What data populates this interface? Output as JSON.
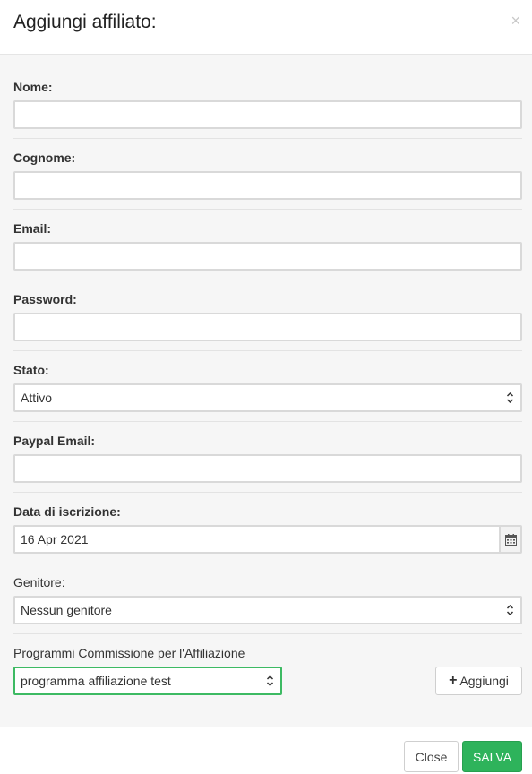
{
  "modal": {
    "title": "Aggiungi affiliato:",
    "close_glyph": "×"
  },
  "form": {
    "nome": {
      "label": "Nome:",
      "value": ""
    },
    "cognome": {
      "label": "Cognome:",
      "value": ""
    },
    "email": {
      "label": "Email:",
      "value": ""
    },
    "password": {
      "label": "Password:",
      "value": ""
    },
    "stato": {
      "label": "Stato:",
      "selected": "Attivo"
    },
    "paypal_email": {
      "label": "Paypal Email:",
      "value": ""
    },
    "data_iscrizione": {
      "label": "Data di iscrizione:",
      "value": "16 Apr 2021"
    },
    "genitore": {
      "label": "Genitore:",
      "selected": "Nessun genitore"
    },
    "programmi": {
      "label": "Programmi Commissione per l'Affiliazione",
      "selected": "programma affiliazione test",
      "add_label": "Aggiungi"
    }
  },
  "footer": {
    "close_label": "Close",
    "save_label": "SALVA"
  },
  "colors": {
    "save_button": "#2eb35b",
    "focus_border": "#3dba63"
  },
  "icons": {
    "close": "close-icon",
    "select": "chevron-updown-icon",
    "calendar": "calendar-icon",
    "add": "plus-icon"
  }
}
